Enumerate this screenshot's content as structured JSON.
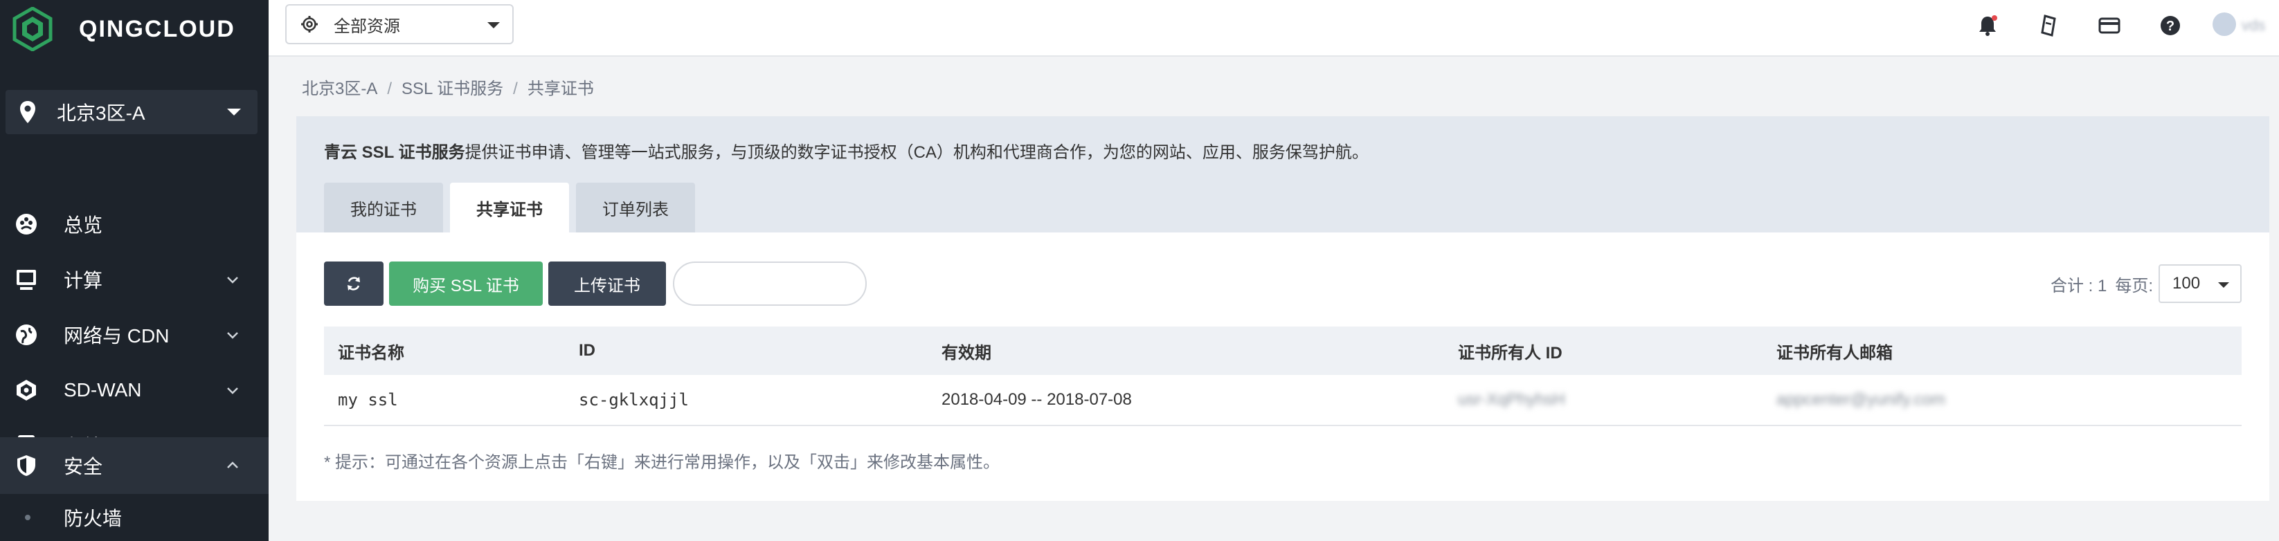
{
  "brand": {
    "name": "QINGCLOUD"
  },
  "sidebar": {
    "zone": "北京3区-A",
    "items": [
      {
        "label": "总览",
        "icon": "dashboard-icon",
        "expandable": false
      },
      {
        "label": "计算",
        "icon": "computer-icon",
        "expandable": true
      },
      {
        "label": "网络与 CDN",
        "icon": "globe-icon",
        "expandable": true
      },
      {
        "label": "SD-WAN",
        "icon": "sdwan-icon",
        "expandable": true
      },
      {
        "label": "存储",
        "icon": "storage-icon",
        "expandable": true
      },
      {
        "label": "安全",
        "icon": "shield-icon",
        "expandable": true,
        "expanded": true
      }
    ],
    "subitem": "防火墙"
  },
  "topbar": {
    "resource_select": "全部资源",
    "user_name": "vds"
  },
  "breadcrumb": [
    "北京3区-A",
    "SSL 证书服务",
    "共享证书"
  ],
  "intro": {
    "bold": "青云 SSL 证书服务",
    "text": "提供证书申请、管理等一站式服务，与顶级的数字证书授权（CA）机构和代理商合作，为您的网站、应用、服务保驾护航。"
  },
  "tabs": [
    {
      "label": "我的证书",
      "active": false
    },
    {
      "label": "共享证书",
      "active": true
    },
    {
      "label": "订单列表",
      "active": false
    }
  ],
  "toolbar": {
    "buy_label": "购买 SSL 证书",
    "upload_label": "上传证书",
    "search_placeholder": ""
  },
  "pager": {
    "total_label": "合计 : 1",
    "per_page_label": "每页:",
    "per_page": "100"
  },
  "table": {
    "headers": [
      "证书名称",
      "ID",
      "有效期",
      "证书所有人 ID",
      "证书所有人邮箱"
    ],
    "rows": [
      [
        "my ssl",
        "sc-gklxqjjl",
        "2018-04-09 -- 2018-07-08",
        "usr-XqPhyhsH",
        "appcenter@yunify.com"
      ]
    ]
  },
  "tip": "* 提示：可通过在各个资源上点击「右键」来进行常用操作，以及「双击」来修改基本属性。",
  "colors": {
    "sidebar_bg": "#1d232b",
    "accent_green": "#4caf72",
    "button_dark": "#3b4554",
    "brand_green": "#2fa35f"
  }
}
